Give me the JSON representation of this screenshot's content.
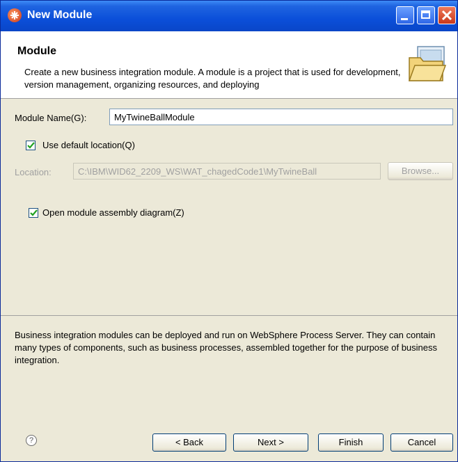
{
  "window": {
    "title": "New Module"
  },
  "banner": {
    "title": "Module",
    "description": "Create a new business integration module. A module is a project that is used for development, version management, organizing resources, and deploying"
  },
  "form": {
    "module_name_label": "Module Name(G):",
    "module_name_value": "MyTwineBallModule",
    "use_default_location_label": "Use default location(Q)",
    "use_default_location_checked": true,
    "location_label": "Location:",
    "location_value": "C:\\IBM\\WID62_2209_WS\\WAT_chagedCode1\\MyTwineBall",
    "browse_label": "Browse...",
    "open_diagram_label": "Open module assembly diagram(Z)",
    "open_diagram_checked": true
  },
  "info": {
    "text": "Business integration modules can be deployed and run on WebSphere Process Server. They can contain many types of components, such as business processes, assembled together for the purpose of business integration."
  },
  "footer": {
    "help_symbol": "?",
    "back_label": "< Back",
    "next_label": "Next >",
    "finish_label": "Finish",
    "cancel_label": "Cancel"
  },
  "colors": {
    "titlebar": "#0b4fd9",
    "dialog_bg": "#ece9d8",
    "banner_bg": "#ffffff",
    "checkmark": "#21a121"
  }
}
